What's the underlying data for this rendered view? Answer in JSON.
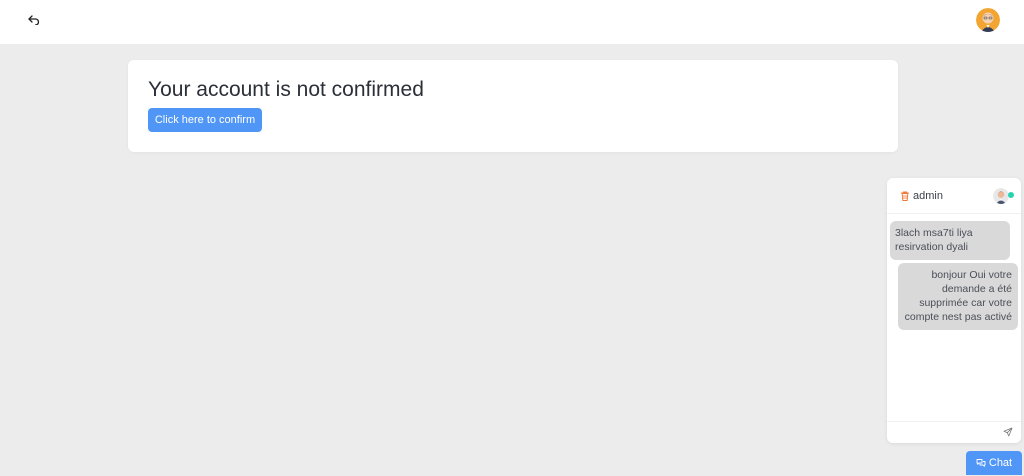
{
  "header": {
    "back_icon": "undo-arrow-icon",
    "avatar_icon": "user-avatar-icon"
  },
  "card": {
    "title": "Your account is not confirmed",
    "confirm_label": "Click here to confirm"
  },
  "chat": {
    "contact_name": "admin",
    "status": "online",
    "messages": [
      {
        "direction": "incoming",
        "text": "3lach msa7ti liya resirvation dyali"
      },
      {
        "direction": "outgoing",
        "text": "bonjour Oui votre demande a été supprimée car votre compte nest pas activé"
      }
    ],
    "input_value": "",
    "toggle_label": "Chat"
  },
  "colors": {
    "accent": "#5096f7",
    "background": "#ececec",
    "online": "#28d3b0",
    "bubble": "#d9d9d9",
    "trash": "#f0793a"
  }
}
